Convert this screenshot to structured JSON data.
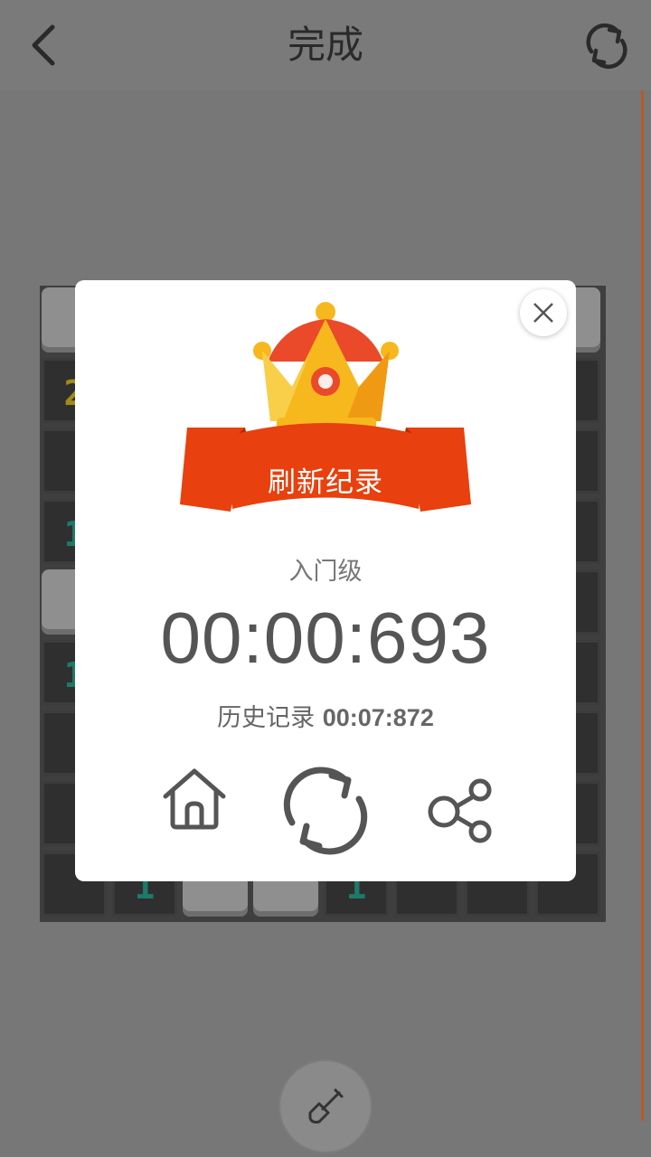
{
  "header": {
    "title": "完成",
    "back_icon": "chevron-left-icon",
    "refresh_icon": "refresh-icon"
  },
  "board": {
    "visible_numbers": [
      {
        "label": "2",
        "color": "#a08a1a"
      },
      {
        "label": "1",
        "color": "#1d7a6a"
      },
      {
        "label": "1",
        "color": "#1d7a6a"
      },
      {
        "label": "1",
        "color": "#1d7a6a"
      },
      {
        "label": "1",
        "color": "#1d7a6a"
      }
    ]
  },
  "dialog": {
    "badge_text": "刷新纪录",
    "level": "入门级",
    "time": "00:00:693",
    "history_label": "历史记录",
    "history_value": "00:07:872",
    "actions": [
      "home-icon",
      "replay-icon",
      "share-icon"
    ],
    "colors": {
      "ribbon": "#e8400e",
      "ribbon_dark": "#c5300a",
      "crown_gold": "#f7b81e",
      "crown_red": "#ea4a2a"
    }
  },
  "footer": {
    "tool_icon": "shovel-icon"
  }
}
